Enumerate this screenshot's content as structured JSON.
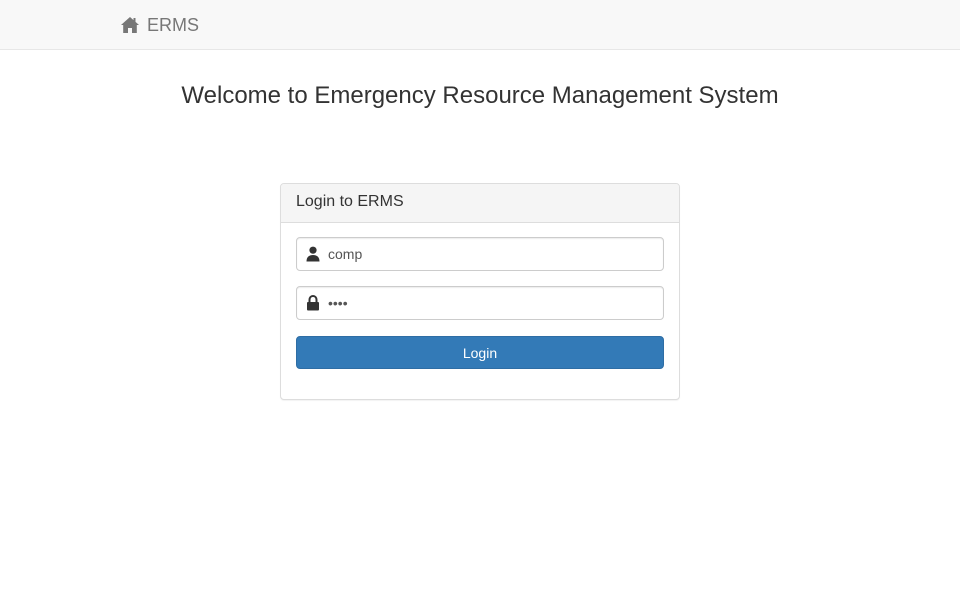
{
  "navbar": {
    "brand_label": "ERMS",
    "brand_icon": "home-icon"
  },
  "welcome": {
    "title": "Welcome to Emergency Resource Management System"
  },
  "login_panel": {
    "heading": "Login to ERMS",
    "username": {
      "icon": "user-icon",
      "value": "comp"
    },
    "password": {
      "icon": "lock-icon",
      "value": "comp"
    },
    "submit_label": "Login"
  },
  "colors": {
    "primary": "#337ab7",
    "navbar_bg": "#f8f8f8",
    "panel_heading_bg": "#f5f5f5",
    "brand_text": "#777777"
  }
}
